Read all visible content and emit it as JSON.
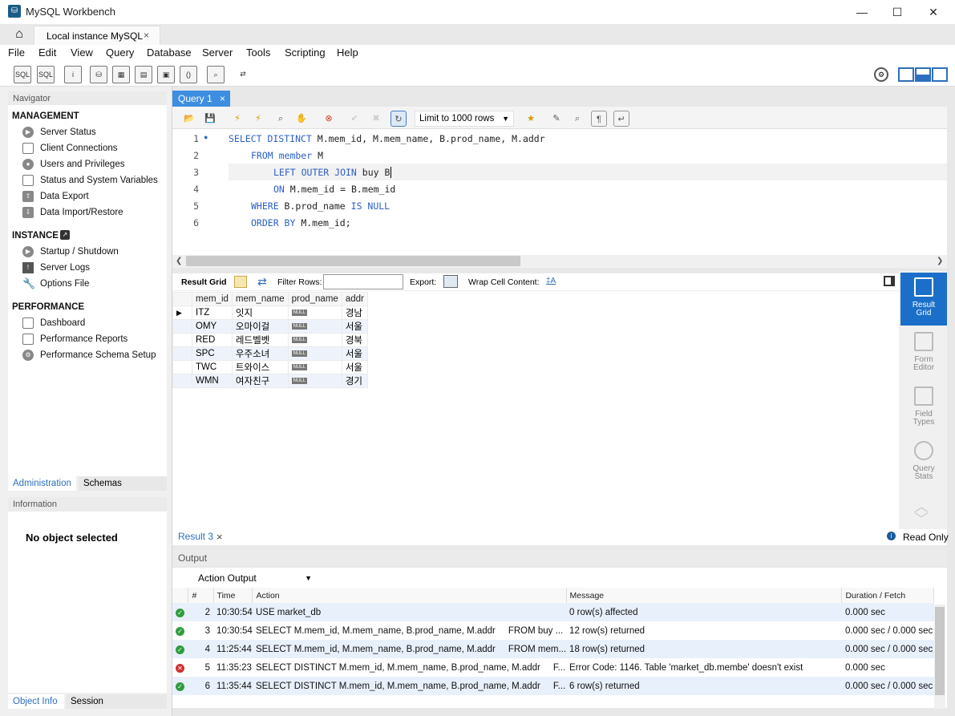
{
  "window": {
    "title": "MySQL Workbench",
    "minimize": "—",
    "maximize": "☐",
    "close": "✕"
  },
  "tabs": {
    "connection_label": "Local instance MySQL",
    "close": "×"
  },
  "menu": [
    "File",
    "Edit",
    "View",
    "Query",
    "Database",
    "Server",
    "Tools",
    "Scripting",
    "Help"
  ],
  "navigator": {
    "header": "Navigator",
    "management_title": "MANAGEMENT",
    "management": [
      "Server Status",
      "Client Connections",
      "Users and Privileges",
      "Status and System Variables",
      "Data Export",
      "Data Import/Restore"
    ],
    "instance_title": "INSTANCE",
    "instance": [
      "Startup / Shutdown",
      "Server Logs",
      "Options File"
    ],
    "performance_title": "PERFORMANCE",
    "performance": [
      "Dashboard",
      "Performance Reports",
      "Performance Schema Setup"
    ],
    "tab_admin": "Administration",
    "tab_schemas": "Schemas"
  },
  "information": {
    "header": "Information",
    "empty": "No object selected",
    "tab_object": "Object Info",
    "tab_session": "Session"
  },
  "editor": {
    "tab_label": "Query 1",
    "tab_close": "×",
    "limit": "Limit to 1000 rows",
    "lines": [
      {
        "no": "1",
        "kw1": "SELECT DISTINCT",
        "rest": " M.mem_id, M.mem_name, B.prod_name, M.addr"
      },
      {
        "no": "2",
        "kw1": "FROM member",
        "rest": " M"
      },
      {
        "no": "3",
        "kw1": "LEFT OUTER JOIN",
        "rest": " buy B"
      },
      {
        "no": "4",
        "kw1": "ON",
        "rest": " M.mem_id = B.mem_id"
      },
      {
        "no": "5",
        "kw1": "WHERE",
        "rest": " B.prod_name ",
        "kw2": "IS NULL"
      },
      {
        "no": "6",
        "kw1": "ORDER BY",
        "rest": " M.mem_id;"
      }
    ]
  },
  "results": {
    "result_grid_label": "Result Grid",
    "filter_label": "Filter Rows:",
    "export_label": "Export:",
    "wrap_label": "Wrap Cell Content:",
    "columns": [
      "mem_id",
      "mem_name",
      "prod_name",
      "addr"
    ],
    "null_label": "NULL",
    "rows": [
      [
        "ITZ",
        "잇지",
        "NULL",
        "경남"
      ],
      [
        "OMY",
        "오마이걸",
        "NULL",
        "서울"
      ],
      [
        "RED",
        "레드벨벳",
        "NULL",
        "경북"
      ],
      [
        "SPC",
        "우주소녀",
        "NULL",
        "서울"
      ],
      [
        "TWC",
        "트와이스",
        "NULL",
        "서울"
      ],
      [
        "WMN",
        "여자친구",
        "NULL",
        "경기"
      ]
    ],
    "tab_label": "Result 3",
    "tab_close": "×",
    "read_only": "Read Only"
  },
  "side_panel": [
    {
      "line1": "Result",
      "line2": "Grid"
    },
    {
      "line1": "Form",
      "line2": "Editor"
    },
    {
      "line1": "Field",
      "line2": "Types"
    },
    {
      "line1": "Query",
      "line2": "Stats"
    }
  ],
  "output": {
    "header": "Output",
    "selector": "Action Output",
    "columns": [
      "#",
      "Time",
      "Action",
      "Message",
      "Duration / Fetch"
    ],
    "rows": [
      {
        "status": "ok",
        "no": "2",
        "time": "10:30:54",
        "action": "USE market_db",
        "message": "0 row(s) affected",
        "duration": "0.000 sec"
      },
      {
        "status": "ok",
        "no": "3",
        "time": "10:30:54",
        "action": "SELECT M.mem_id, M.mem_name, B.prod_name, M.addr     FROM buy ...",
        "message": "12 row(s) returned",
        "duration": "0.000 sec / 0.000 sec"
      },
      {
        "status": "ok",
        "no": "4",
        "time": "11:25:44",
        "action": "SELECT M.mem_id, M.mem_name, B.prod_name, M.addr     FROM mem...",
        "message": "18 row(s) returned",
        "duration": "0.000 sec / 0.000 sec"
      },
      {
        "status": "err",
        "no": "5",
        "time": "11:35:23",
        "action": "SELECT DISTINCT M.mem_id, M.mem_name, B.prod_name, M.addr     F...",
        "message": "Error Code: 1146. Table 'market_db.membe' doesn't exist",
        "duration": "0.000 sec"
      },
      {
        "status": "ok",
        "no": "6",
        "time": "11:35:44",
        "action": "SELECT DISTINCT M.mem_id, M.mem_name, B.prod_name, M.addr     F...",
        "message": "6 row(s) returned",
        "duration": "0.000 sec / 0.000 sec"
      }
    ]
  }
}
